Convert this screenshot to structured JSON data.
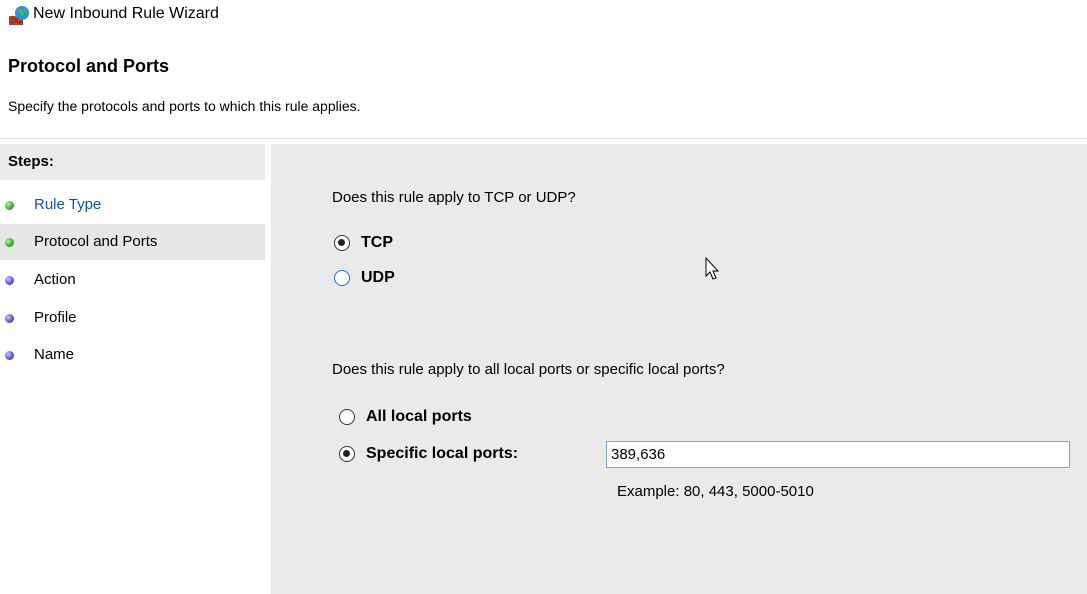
{
  "window": {
    "title": "New Inbound Rule Wizard",
    "icon": "firewall-rule-icon"
  },
  "header": {
    "title": "Protocol and Ports",
    "subtitle": "Specify the protocols and ports to which this rule applies."
  },
  "steps": {
    "heading": "Steps:",
    "items": [
      {
        "label": "Rule Type",
        "status": "completed",
        "dot_color": "green"
      },
      {
        "label": "Protocol and Ports",
        "status": "current",
        "dot_color": "green"
      },
      {
        "label": "Action",
        "status": "pending",
        "dot_color": "blue"
      },
      {
        "label": "Profile",
        "status": "pending",
        "dot_color": "blue"
      },
      {
        "label": "Name",
        "status": "pending",
        "dot_color": "blue"
      }
    ]
  },
  "protocol": {
    "question": "Does this rule apply to TCP or UDP?",
    "options": [
      {
        "label": "TCP",
        "checked": true
      },
      {
        "label": "UDP",
        "checked": false
      }
    ]
  },
  "ports": {
    "question": "Does this rule apply to all local ports or specific local ports?",
    "options": [
      {
        "label": "All local ports",
        "checked": false
      },
      {
        "label": "Specific local ports:",
        "checked": true
      }
    ],
    "value": "389,636",
    "example": "Example: 80, 443, 5000-5010"
  },
  "colors": {
    "link": "#0b56b4",
    "content_bg": "#eaeaea",
    "current_step_bg": "#e6e6e6"
  }
}
